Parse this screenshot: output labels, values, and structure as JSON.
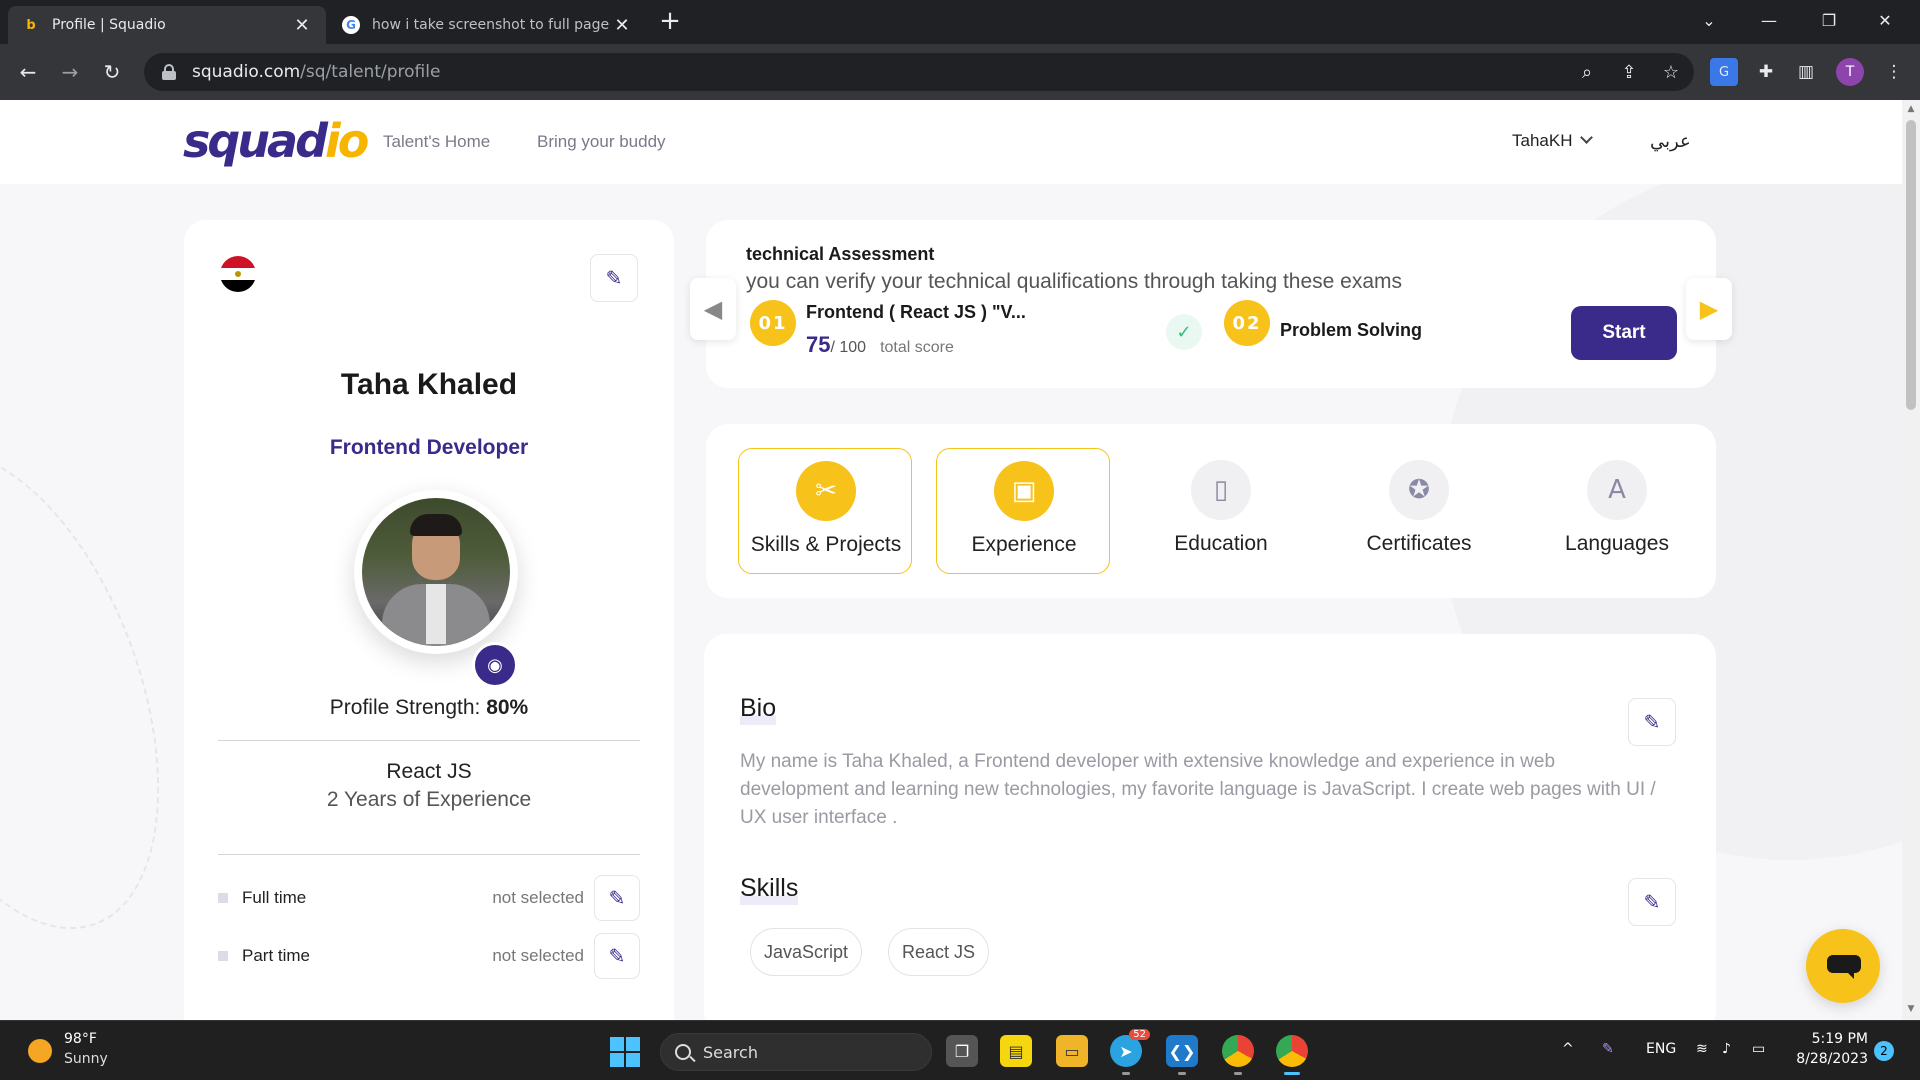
{
  "browser": {
    "tabs": [
      {
        "title": "Profile | Squadio",
        "favicon": "squadio-icon"
      },
      {
        "title": "how i take screenshot to full page in",
        "favicon": "google-icon"
      }
    ],
    "url_host": "squadio.com",
    "url_path": "/sq/talent/profile",
    "profile_initial": "T"
  },
  "site": {
    "logo_main": "squad",
    "logo_accent": "io",
    "nav": [
      "Talent's Home",
      "Bring your buddy"
    ],
    "user": "TahaKH",
    "language_switch": "عربي"
  },
  "profile": {
    "name": "Taha Khaled",
    "role": "Frontend Developer",
    "strength_label": "Profile Strength:",
    "strength_value": "80%",
    "main_skill": "React JS",
    "experience": "2 Years of Experience",
    "preferences": [
      {
        "label": "Full time",
        "value": "not selected"
      },
      {
        "label": "Part time",
        "value": "not selected"
      }
    ]
  },
  "assessment": {
    "title": "technical Assessment",
    "subtitle": "you can verify your technical qualifications through taking these exams",
    "exams": [
      {
        "number": "01",
        "name": "Frontend ( React JS ) \"V...",
        "score": "75",
        "max": "/ 100",
        "score_label": "total score"
      },
      {
        "number": "02",
        "name": "Problem Solving"
      }
    ],
    "start_label": "Start"
  },
  "sections": [
    {
      "label": "Skills & Projects",
      "icon": "tools-icon",
      "selected": true
    },
    {
      "label": "Experience",
      "icon": "briefcase-icon",
      "selected": true
    },
    {
      "label": "Education",
      "icon": "book-icon",
      "selected": false
    },
    {
      "label": "Certificates",
      "icon": "award-icon",
      "selected": false
    },
    {
      "label": "Languages",
      "icon": "translate-icon",
      "selected": false
    }
  ],
  "bio": {
    "title": "Bio",
    "text": "My name is Taha Khaled, a Frontend developer with extensive knowledge and experience in web development and learning new technologies, my favorite language is JavaScript. I create web pages with UI / UX user interface ."
  },
  "skills": {
    "title": "Skills",
    "items": [
      "JavaScript",
      "React JS"
    ]
  },
  "taskbar": {
    "temperature": "98°F",
    "condition": "Sunny",
    "search_label": "Search",
    "telegram_badge": "52",
    "language": "ENG",
    "time": "5:19 PM",
    "date": "8/28/2023",
    "notifications": "2"
  },
  "colors": {
    "brand_purple": "#3a2a8a",
    "brand_yellow": "#f7c21a"
  }
}
